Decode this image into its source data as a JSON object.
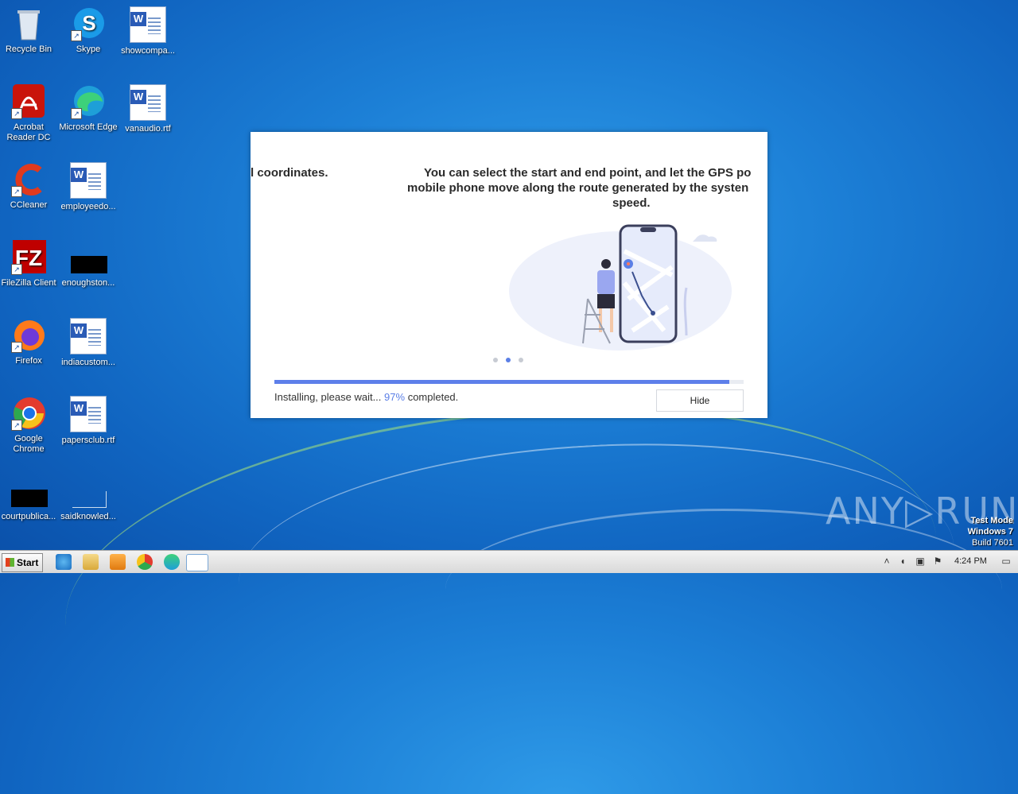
{
  "desktop": {
    "icons": {
      "recycle_bin": "Recycle Bin",
      "skype": "Skype",
      "showcompa": "showcompa...",
      "acrobat": "Acrobat\nReader DC",
      "edge": "Microsoft Edge",
      "vanaudio": "vanaudio.rtf",
      "ccleaner": "CCleaner",
      "employeedo": "employeedo...",
      "filezilla": "FileZilla Client",
      "enoughston": "enoughston...",
      "firefox": "Firefox",
      "indiacustom": "indiacustom...",
      "chrome": "Google\nChrome",
      "papersclub": "papersclub.rtf",
      "courtpublica": "courtpublica...",
      "saidknowled": "saidknowled..."
    }
  },
  "installer": {
    "slide_prev": "l coordinates.",
    "slide_line1": "You can select the start and end point, and let the GPS po",
    "slide_line2": "mobile phone move along the route generated by the systen",
    "slide_line3": "speed.",
    "status_prefix": "Installing, please wait...",
    "status_percent": "97%",
    "status_suffix": "completed.",
    "progress": 0.97,
    "hide_label": "Hide",
    "accent_color": "#5b7fe6"
  },
  "taskbar": {
    "start_label": "Start",
    "clock": "4:24 PM"
  },
  "watermark": {
    "brand": "ANY▷RUN",
    "mode": "Test Mode",
    "os": "Windows 7",
    "build": "Build 7601"
  }
}
